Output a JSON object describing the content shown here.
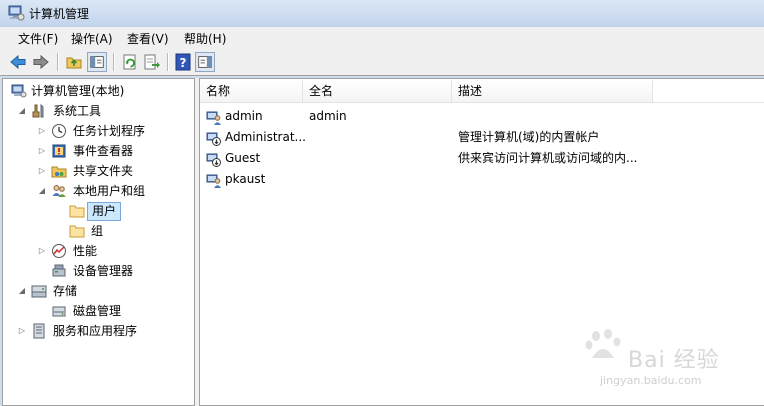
{
  "window": {
    "title": "计算机管理"
  },
  "menu": [
    {
      "label": "文件(F)"
    },
    {
      "label": "操作(A)"
    },
    {
      "label": "查看(V)"
    },
    {
      "label": "帮助(H)"
    }
  ],
  "tree": {
    "root": {
      "label": "计算机管理(本地)"
    },
    "system_tools": {
      "label": "系统工具"
    },
    "task_scheduler": {
      "label": "任务计划程序"
    },
    "event_viewer": {
      "label": "事件查看器"
    },
    "shared_folders": {
      "label": "共享文件夹"
    },
    "local_users_groups": {
      "label": "本地用户和组"
    },
    "users": {
      "label": "用户"
    },
    "groups": {
      "label": "组"
    },
    "performance": {
      "label": "性能"
    },
    "device_manager": {
      "label": "设备管理器"
    },
    "storage": {
      "label": "存储"
    },
    "disk_management": {
      "label": "磁盘管理"
    },
    "services_apps": {
      "label": "服务和应用程序"
    }
  },
  "list": {
    "columns": [
      {
        "label": "名称"
      },
      {
        "label": "全名"
      },
      {
        "label": "描述"
      }
    ],
    "rows": [
      {
        "name": "admin",
        "full_name": "admin",
        "description": "",
        "icon": "user-icon"
      },
      {
        "name": "Administrat...",
        "full_name": "",
        "description": "管理计算机(域)的内置帐户",
        "icon": "disabled-user-icon"
      },
      {
        "name": "Guest",
        "full_name": "",
        "description": "供来宾访问计算机或访问域的内...",
        "icon": "disabled-user-icon"
      },
      {
        "name": "pkaust",
        "full_name": "",
        "description": "",
        "icon": "user-icon"
      }
    ]
  },
  "watermark": {
    "text": "Bai 经验",
    "sub": "jingyan.baidu.com"
  }
}
